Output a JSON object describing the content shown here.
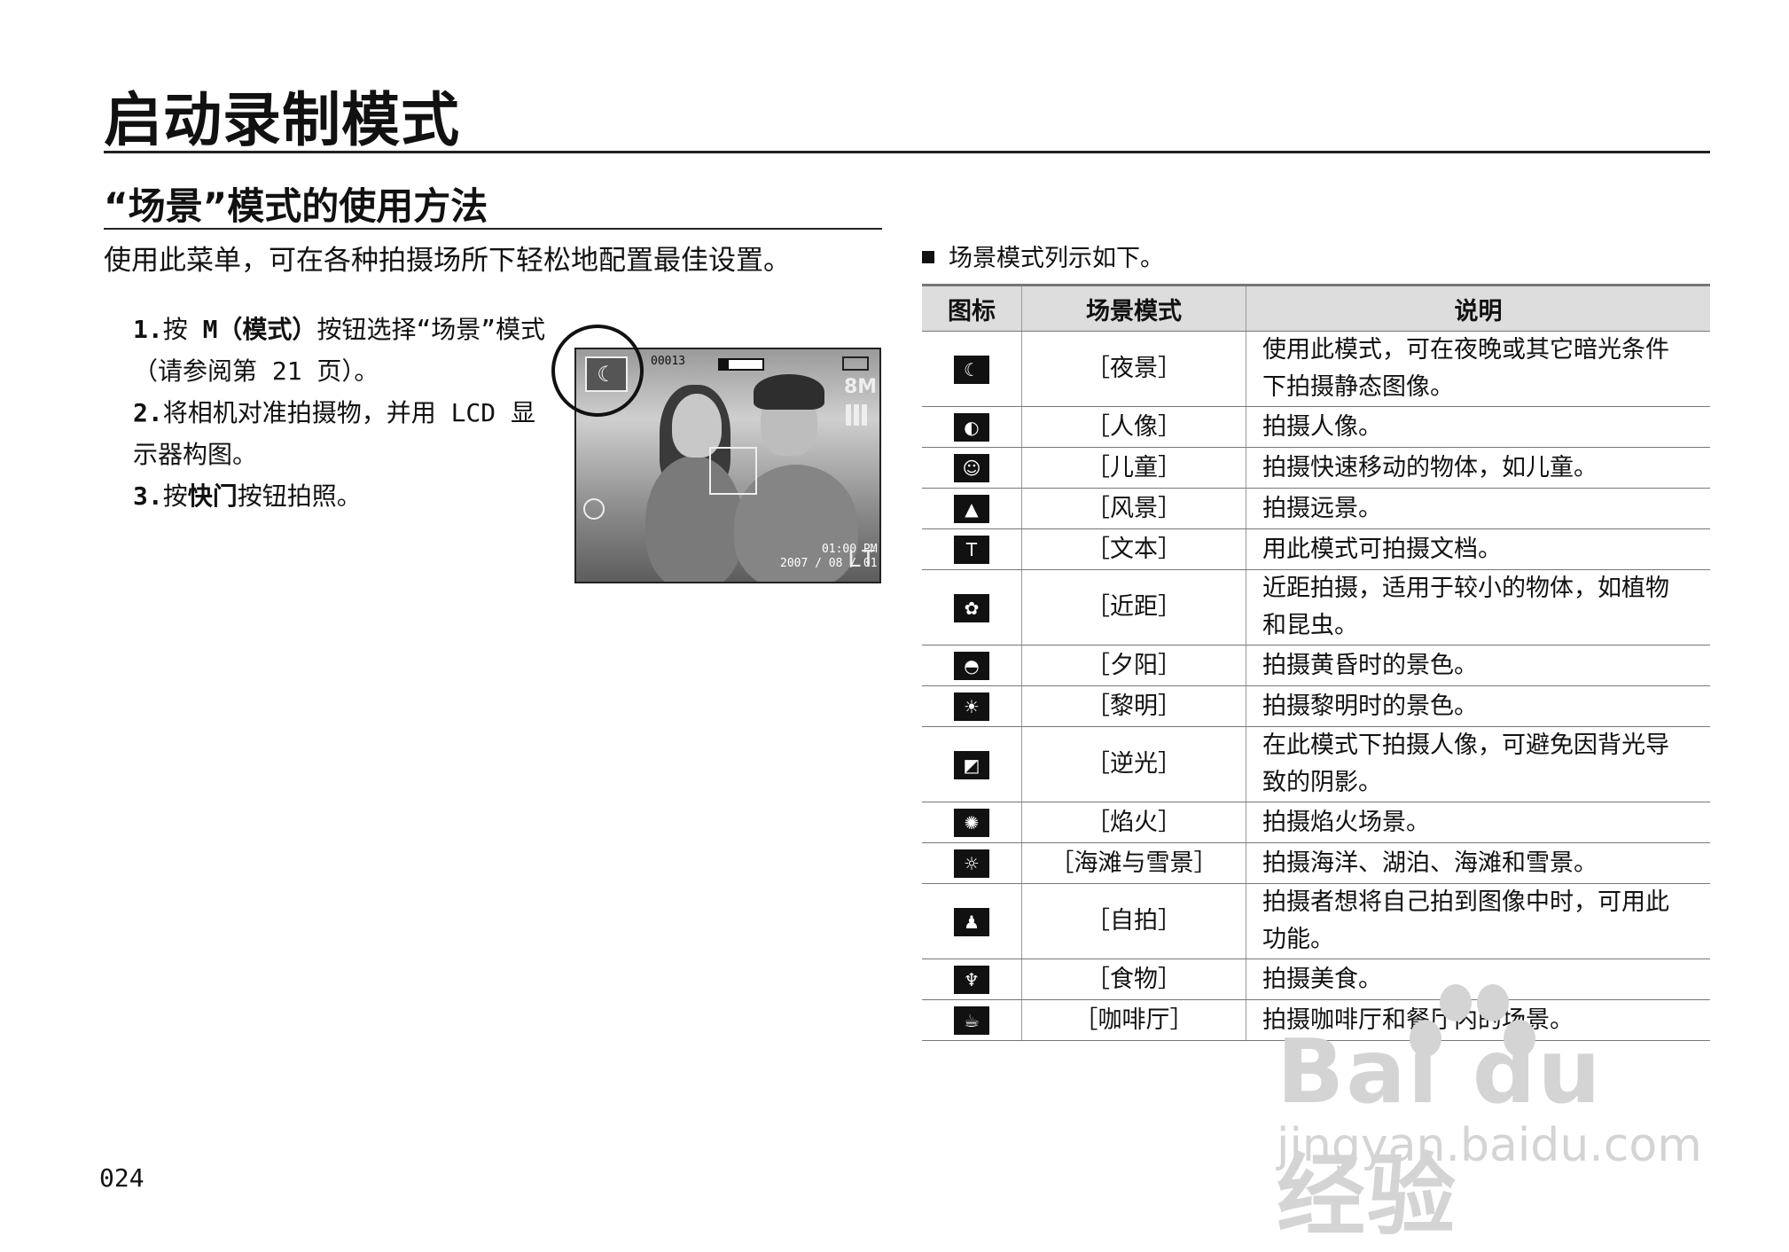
{
  "header": {
    "title": "启动录制模式",
    "section": "“场景”模式的使用方法",
    "intro": "使用此菜单，可在各种拍摄场所下轻松地配置最佳设置。"
  },
  "steps": [
    {
      "num": "1.",
      "pre": "按 ",
      "bold": "M（模式）",
      "post": "按钮选择“场景”模式（请参阅第 21 页）。"
    },
    {
      "num": "2.",
      "pre": "将相机对准拍摄物，并用 LCD 显示器构图。",
      "bold": "",
      "post": ""
    },
    {
      "num": "3.",
      "pre": "按",
      "bold": "快门",
      "post": "按钮拍照。"
    }
  ],
  "camera": {
    "counter": "00013",
    "size": "8M",
    "time": "01:00 PM",
    "date": "2007 / 08 / 01",
    "quality": "LT"
  },
  "list_heading": "场景模式列示如下。",
  "table": {
    "headers": [
      "图标",
      "场景模式",
      "说明"
    ],
    "rows": [
      {
        "icon": "night-icon",
        "glyph": "☾",
        "mode": "［夜景］",
        "desc": "使用此模式，可在夜晚或其它暗光条件下拍摄静态图像。"
      },
      {
        "icon": "portrait-icon",
        "glyph": "◐",
        "mode": "［人像］",
        "desc": "拍摄人像。"
      },
      {
        "icon": "children-icon",
        "glyph": "☺",
        "mode": "［儿童］",
        "desc": "拍摄快速移动的物体，如儿童。"
      },
      {
        "icon": "landscape-icon",
        "glyph": "▲",
        "mode": "［风景］",
        "desc": "拍摄远景。"
      },
      {
        "icon": "text-icon",
        "glyph": "T",
        "mode": "［文本］",
        "desc": "用此模式可拍摄文档。"
      },
      {
        "icon": "closeup-icon",
        "glyph": "✿",
        "mode": "［近距］",
        "desc": "近距拍摄，适用于较小的物体，如植物和昆虫。"
      },
      {
        "icon": "sunset-icon",
        "glyph": "◓",
        "mode": "［夕阳］",
        "desc": "拍摄黄昏时的景色。"
      },
      {
        "icon": "dawn-icon",
        "glyph": "☀",
        "mode": "［黎明］",
        "desc": "拍摄黎明时的景色。"
      },
      {
        "icon": "backlight-icon",
        "glyph": "◩",
        "mode": "［逆光］",
        "desc": "在此模式下拍摄人像，可避免因背光导致的阴影。"
      },
      {
        "icon": "firework-icon",
        "glyph": "✺",
        "mode": "［焰火］",
        "desc": "拍摄焰火场景。"
      },
      {
        "icon": "beach-snow-icon",
        "glyph": "☼",
        "mode": "［海滩与雪景］",
        "desc": "拍摄海洋、湖泊、海滩和雪景。"
      },
      {
        "icon": "self-shot-icon",
        "glyph": "♟",
        "mode": "［自拍］",
        "desc": "拍摄者想将自己拍到图像中时，可用此功能。"
      },
      {
        "icon": "food-icon",
        "glyph": "♆",
        "mode": "［食物］",
        "desc": "拍摄美食。"
      },
      {
        "icon": "cafe-icon",
        "glyph": "☕",
        "mode": "［咖啡厅］",
        "desc": "拍摄咖啡厅和餐厅内的场景。"
      }
    ]
  },
  "page_number": "024",
  "watermark": {
    "logo": "Bai du 经验",
    "sub": "jingyan.baidu.com"
  }
}
